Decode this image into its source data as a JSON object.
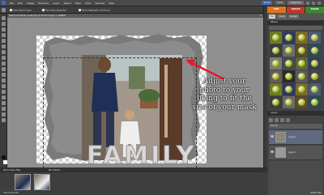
{
  "menubar": {
    "menus": [
      "File",
      "Edit",
      "Image",
      "Enhance",
      "Layer",
      "Select",
      "Filter",
      "View",
      "Window",
      "Help"
    ],
    "undo_label": "Undo",
    "redo_label": "Redo",
    "organizer_label": "Organizer"
  },
  "options": {
    "auto_select": "Auto Select Layer",
    "bounding_box": "Show Bounding Box",
    "highlight": "Show Highlight on Rollover"
  },
  "document": {
    "tab_title": "Katherine-Family-mask.psd @ 33.3% (Layer 1, RGB/8)"
  },
  "canvas": {
    "overlay_text": "Adjust your photo to your liking to fit the size of your mask",
    "photo_word": "FAMILY",
    "arrow_color": "#e8182a"
  },
  "panel": {
    "mode_tabs": [
      "EDIT",
      "CREATE",
      "SHARE"
    ],
    "mode_colors": [
      "#e0731b",
      "#c0392b",
      "#3a8a2f"
    ],
    "sub_tabs": [
      "Full",
      "Quick",
      "Guided"
    ],
    "effects_title": "Effects",
    "layers_title": "Layers",
    "blend_mode": "Normal",
    "layers": [
      {
        "name": "Layer 1"
      },
      {
        "name": "Layer 0"
      }
    ],
    "palette_bin": "Palette Bin"
  },
  "bin": {
    "show_open_files": "Show Open Files",
    "bin_actions": "Bin Actions",
    "hide_bin": "Hide Project Bin"
  }
}
